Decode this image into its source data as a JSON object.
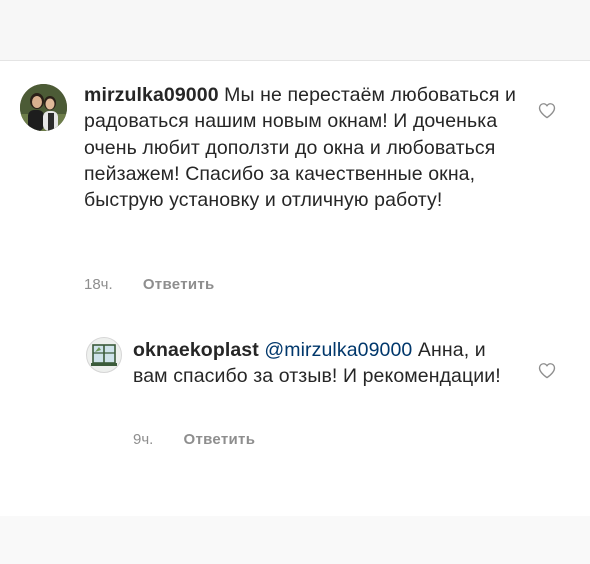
{
  "comments": [
    {
      "username": "mirzulka09000",
      "text": "Мы не перестаём любоваться и радоваться нашим новым окнам! И доченька очень любит доползти до окна и любоваться пейзажем! Спасибо за качественные окна, быструю установку и отличную работу!",
      "time": "18ч.",
      "reply_label": "Ответить",
      "avatar_icon": "user-photo",
      "like_icon": "heart-outline-icon"
    },
    {
      "username": "oknaekoplast",
      "mention": "@mirzulka09000",
      "text": "Анна, и вам спасибо за отзыв! И рекомендации!",
      "time": "9ч.",
      "reply_label": "Ответить",
      "avatar_icon": "window-logo",
      "like_icon": "heart-outline-icon"
    }
  ],
  "colors": {
    "text": "#262626",
    "secondary": "#8e8e8e",
    "mention": "#00376b"
  }
}
